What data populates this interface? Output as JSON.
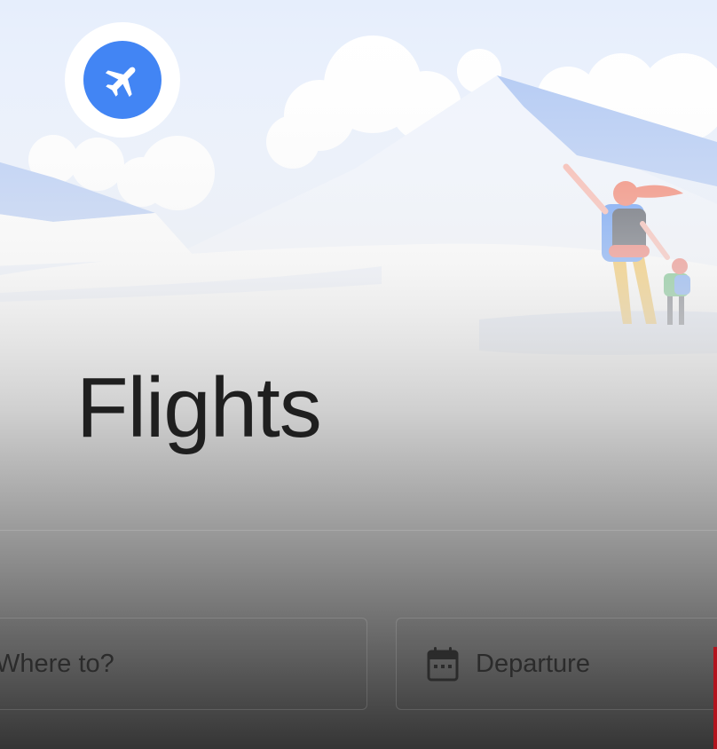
{
  "app": {
    "title": "Flights"
  },
  "search": {
    "destination_placeholder": "Where to?",
    "departure_placeholder": "Departure"
  },
  "icons": {
    "logo": "airplane-icon",
    "departure": "calendar-icon"
  },
  "colors": {
    "sky": "#e6eefc",
    "logo_blue": "#4285f4",
    "title_text": "#1f1f1f",
    "accent_red": "#b3141e"
  }
}
